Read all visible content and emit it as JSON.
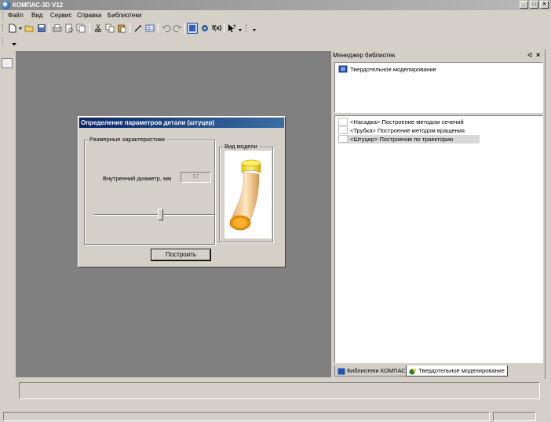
{
  "window": {
    "title": "КОМПАС-3D V12",
    "title_color": "#ffffff"
  },
  "menu": {
    "items": [
      "Файл",
      "Вид",
      "Сервис",
      "Справка",
      "Библиотеки"
    ]
  },
  "toolbar": {
    "icons": [
      "new-document-icon",
      "dropdown-arrow-icon",
      "open-icon",
      "save-icon",
      "print-icon",
      "print-preview-icon",
      "copy-preview-icon",
      "cut-icon",
      "copy-icon",
      "paste-icon",
      "properties-icon",
      "table-icon",
      "undo-icon",
      "redo-icon",
      "library-manager-icon",
      "settings-icon",
      "variables-icon",
      "help-cursor-icon"
    ],
    "variables_label": "f(x)"
  },
  "dialog": {
    "title": "Определение параметров детали (штуцер)",
    "group_label": "Размерные характеристики",
    "preview_label": "Вид модели",
    "diameter_label": "Внутренний диаметр, мм",
    "diameter_value": "57",
    "slider_level": 0.55,
    "build_button": "Построить"
  },
  "library_manager": {
    "title": "Менеджер библиотек",
    "tree_item": "Твердотельное моделирование",
    "items": [
      "<Насадка> Построение методом сечений",
      "<Трубка>  Построение методом вращения",
      "<Штуцер>  Построение по траектории"
    ],
    "selected_index": 2,
    "tabs": [
      "Библиотеки КОМПАС",
      "Твердотельное моделирование"
    ]
  },
  "colors": {
    "workspace": "#808080",
    "dialog_title": "#0a246a",
    "panel": "#d4d0c8"
  }
}
